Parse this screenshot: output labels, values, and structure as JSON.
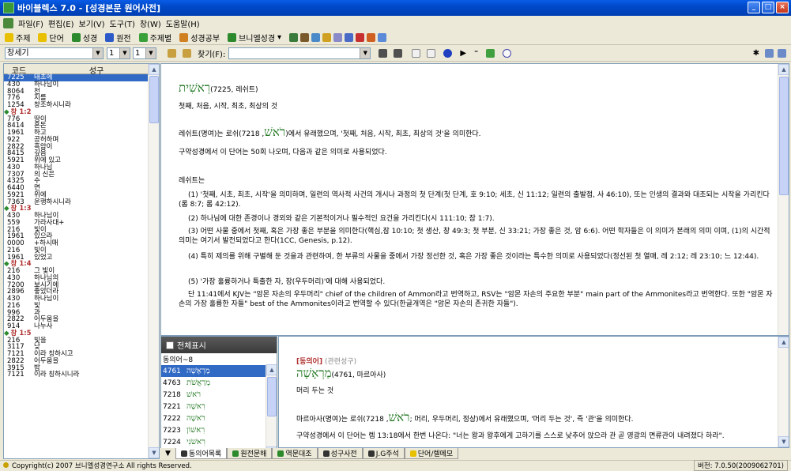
{
  "window": {
    "title": "바이블렉스 7.0 - [성경본문 원어사전]",
    "min": "_",
    "max": "□",
    "close": "×"
  },
  "menu": [
    "파일(F)",
    "편집(E)",
    "보기(V)",
    "도구(T)",
    "창(W)",
    "도움말(H)"
  ],
  "toolbar1": [
    "주제",
    "단어",
    "성경",
    "원전",
    "주제별",
    "성경공부",
    "브니엘성경"
  ],
  "toolbar2": {
    "book": "창세기",
    "chapter": "1",
    "verse": "1",
    "search_label": "찾기(F):",
    "search_value": ""
  },
  "left_header": {
    "col1": "코드",
    "col2": "성구"
  },
  "left_rows": [
    {
      "c": "7225",
      "t": "태초에",
      "sel": true
    },
    {
      "c": "430",
      "t": "하나님이"
    },
    {
      "c": "8064",
      "t": "천"
    },
    {
      "c": "776",
      "t": "지를"
    },
    {
      "c": "1254",
      "t": "창조하시니라"
    },
    {
      "ref": "창 1:2"
    },
    {
      "c": "776",
      "t": "땅이"
    },
    {
      "c": "8414",
      "t": "혼돈"
    },
    {
      "c": "1961",
      "t": "하고"
    },
    {
      "c": "922",
      "t": "공허하며"
    },
    {
      "c": "2822",
      "t": "흑암이"
    },
    {
      "c": "8415",
      "t": "깊음"
    },
    {
      "c": "5921",
      "t": "위에 있고"
    },
    {
      "c": "430",
      "t": "하나님"
    },
    {
      "c": "7307",
      "t": "의 신은"
    },
    {
      "c": "4325",
      "t": "수"
    },
    {
      "c": "6440",
      "t": "면"
    },
    {
      "c": "5921",
      "t": "위에"
    },
    {
      "c": "7363",
      "t": "운행하시니라"
    },
    {
      "ref": "창 1:3"
    },
    {
      "c": "430",
      "t": "하나님이"
    },
    {
      "c": "559",
      "t": "가라사대+"
    },
    {
      "c": "216",
      "t": "빛이"
    },
    {
      "c": "1961",
      "t": "있으라"
    },
    {
      "c": "0000",
      "t": "+하시매"
    },
    {
      "c": "216",
      "t": "빛이"
    },
    {
      "c": "1961",
      "t": "있었고"
    },
    {
      "ref": "창 1:4"
    },
    {
      "c": "216",
      "t": "그 빛이"
    },
    {
      "c": "430",
      "t": "하나님의"
    },
    {
      "c": "7200",
      "t": "보시기에"
    },
    {
      "c": "2896",
      "t": "좋았더라"
    },
    {
      "c": "430",
      "t": "하나님이"
    },
    {
      "c": "216",
      "t": "빛"
    },
    {
      "c": "996",
      "t": "과"
    },
    {
      "c": "2822",
      "t": "어두움을"
    },
    {
      "c": "914",
      "t": "나누사"
    },
    {
      "ref": "창 1:5"
    },
    {
      "c": "216",
      "t": "빛을"
    },
    {
      "c": "3117",
      "t": "낮"
    },
    {
      "c": "7121",
      "t": "이라 칭하시고"
    },
    {
      "c": "2822",
      "t": "어두움을"
    },
    {
      "c": "3915",
      "t": "밤"
    },
    {
      "c": "7121",
      "t": "이라 칭하시니라"
    }
  ],
  "main": {
    "heb": "רֵאשִׁית",
    "heb_ref": "(7225, 레쉬트)",
    "gloss": "첫째, 처음, 시작, 최초, 최상의 것",
    "p1a": "레쉬트(명여)는 로쉬(",
    "p1heb": "רֹאשׁ",
    "p1b": ", 7218)에서 유래했으며, '첫째, 처음, 시작, 최초, 최상의 것'을 의미한다.",
    "p2": "구약성경에서 이 단어는 50회 나오며, 다음과 같은 의미로 사용되었다.",
    "p3": "레쉬트는",
    "p4": "(1) '첫째, 시초, 최초, 시작'을 의미하며, 일련의 역사적 사건의 개시나 과정의 첫 단계(첫 단계, 호 9:10; 세초, 신 11:12; 일련의 출발점, 사 46:10), 또는 인생의 결과와 대조되는 시작을 가리킨다(롬 8:7; 롬 42:12).",
    "p5": "(2) 하나님에 대한 존경이나 경외와 같은 기본적이거나 필수적인 요건을 가리킨다(시 111:10; 잠 1:7).",
    "p6": "(3) 어떤 사물 중에서 첫째, 혹은 가장 좋은 부분을 의미한다(핵심,잠 10:10; 첫 생산, 창 49:3; 첫 부분, 신 33:21; 가장 좋은 것, 암 6:6). 어떤 학자들은 이 의미가 본래의 의미 이며, (1)의 시간적 의미는 여기서 발전되었다고 한다(1CC, Genesis, p.12).",
    "p7": "(4) 특히 제의를 위해 구별해 둔 것을과 관련하여, 한 부류의 사물을 중에서 가장 정선한 것, 혹은 가장 좋은 것이라는 특수한 의미로 사용되었다(정선된 첫 열매, 레 2:12; 레 23:10; 느 12:44).",
    "p8": "(5) '가장 훌륭하거나 특출한 자, 장(우두머리)'에 대해 사용되었다.",
    "p9": "단 11:41에서 KJV는 \"암몬 자손의 우두머리\" chief of the children of Ammon라고 번역하고, RSV는 \"암몬 자손의 주요한 부분\" main part of the Ammonites라고 번역한다. 또한 \"암몬 자손의 가장 훌륭한 자들\" best of the Ammonites이라고 번역할 수 있다(한글개역은 \"암몬 자손의 존귀한 자들\")."
  },
  "syn": {
    "header": "전체표시",
    "count_label": "동의어~8",
    "rows": [
      {
        "n": "4761",
        "h": "מַרְאָשָׁה",
        "sel": true
      },
      {
        "n": "4763",
        "h": "מְרַאֲשֹׁת"
      },
      {
        "n": "7218",
        "h": "רֹאשׁ"
      },
      {
        "n": "7221",
        "h": "רִאשָׁה"
      },
      {
        "n": "7222",
        "h": "רֹאשָׁה"
      },
      {
        "n": "7223",
        "h": "רִאשׁוֹן"
      },
      {
        "n": "7224",
        "h": "רִאשֹׁנִי"
      }
    ]
  },
  "detail": {
    "tag": "[동의어]",
    "tag2": "(관련성구)",
    "heb": "מַרְאָשָׁה",
    "heb_ref": "(4761, 마르아사)",
    "gloss": "머리 두는 것",
    "p1a": "마르아사(명여)는 로쉬(",
    "p1heb": "רֹאשׁ",
    "p1b": ", 7218; 머리, 우두머리, 정상)에서 유래했으며, '머리 두는 것', 즉 '관'을 의미한다.",
    "p2": "구약성경에서 이 단어는 렘 13:18에서 한번 나온다: \"너는 왕과 왕후에게 고하기를 스스로 낮추어 앉으라 관 곧 영광의 면류관이 내려졌다 하라\"."
  },
  "tabs": [
    "동의어목록",
    "원전문해",
    "역문대조",
    "성구사전",
    "J.G주석",
    "단어/렐메모"
  ],
  "status": {
    "copyright": "Copyright(c) 2007 브니엘성경연구소 All rights Reserved.",
    "version": "버전: 7.0.50(2009062701)"
  }
}
